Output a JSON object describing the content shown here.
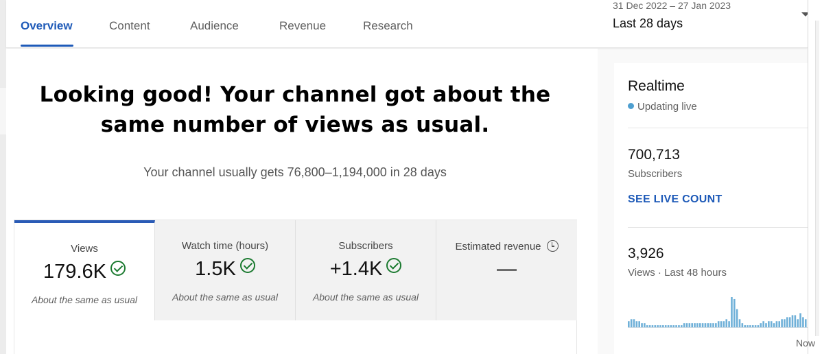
{
  "tabs": [
    {
      "label": "Overview",
      "active": true
    },
    {
      "label": "Content",
      "active": false
    },
    {
      "label": "Audience",
      "active": false
    },
    {
      "label": "Revenue",
      "active": false
    },
    {
      "label": "Research",
      "active": false
    }
  ],
  "date_picker": {
    "range": "31 Dec 2022 – 27 Jan 2023",
    "period": "Last 28 days"
  },
  "summary": {
    "headline_line1": "Looking good! Your channel got about the",
    "headline_line2": "same number of views as usual.",
    "subline": "Your channel usually gets 76,800–1,194,000 in 28 days"
  },
  "metrics": [
    {
      "label": "Views",
      "value": "179.6K",
      "note": "About the same as usual",
      "status_icon": "check-circle-icon"
    },
    {
      "label": "Watch time (hours)",
      "value": "1.5K",
      "note": "About the same as usual",
      "status_icon": "check-circle-icon"
    },
    {
      "label": "Subscribers",
      "value": "+1.4K",
      "note": "About the same as usual",
      "status_icon": "check-circle-icon"
    },
    {
      "label": "Estimated revenue",
      "value": "—",
      "note": "",
      "status_icon": "clock-icon"
    }
  ],
  "realtime": {
    "title": "Realtime",
    "live_label": "Updating live",
    "subscribers_value": "700,713",
    "subscribers_label": "Subscribers",
    "live_count_link": "SEE LIVE COUNT",
    "views_value": "3,926",
    "views_label": "Views · Last 48 hours",
    "axis_end": "Now",
    "bars": [
      3,
      4,
      4,
      3,
      3,
      2,
      2,
      1,
      1,
      1,
      1,
      1,
      1,
      1,
      1,
      1,
      1,
      1,
      1,
      1,
      1,
      2,
      2,
      2,
      2,
      2,
      2,
      2,
      2,
      2,
      2,
      2,
      2,
      2,
      3,
      3,
      3,
      4,
      3,
      15,
      14,
      9,
      4,
      2,
      1,
      1,
      1,
      1,
      1,
      1,
      2,
      3,
      2,
      3,
      3,
      2,
      3,
      3,
      4,
      4,
      5,
      5,
      6,
      6,
      4,
      7,
      5,
      4
    ],
    "colors": {
      "bar": "#6fb0d8",
      "link": "#1e5ab8",
      "dot": "#4e9fd0"
    }
  },
  "colors": {
    "accent": "#1e5ab8",
    "ok": "#1b7a30"
  }
}
